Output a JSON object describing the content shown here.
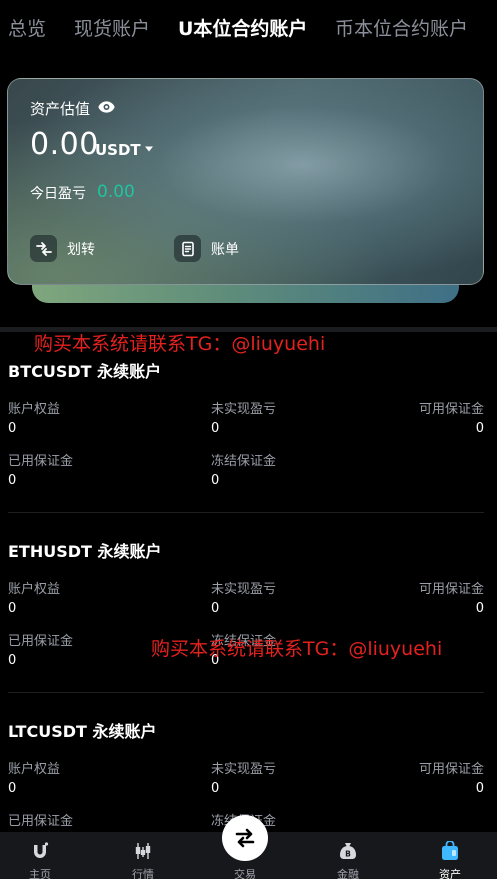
{
  "tabs": [
    {
      "label": "总览",
      "active": false
    },
    {
      "label": "现货账户",
      "active": false
    },
    {
      "label": "U本位合约账户",
      "active": true
    },
    {
      "label": "币本位合约账户",
      "active": false
    }
  ],
  "asset_card": {
    "estimate_label": "资产估值",
    "balance": "0.00",
    "unit": "USDT",
    "today_pnl_label": "今日盈亏",
    "today_pnl_value": "0.00",
    "transfer_label": "划转",
    "bill_label": "账单"
  },
  "watermark": "购买本系统请联系TG：@liuyuehi",
  "accounts": [
    {
      "title": "BTCUSDT 永续账户",
      "equity_label": "账户权益",
      "equity": "0",
      "unrealized_label": "未实现盈亏",
      "unrealized": "0",
      "available_label": "可用保证金",
      "available": "0",
      "used_label": "已用保证金",
      "used": "0",
      "frozen_label": "冻结保证金",
      "frozen": "0"
    },
    {
      "title": "ETHUSDT 永续账户",
      "equity_label": "账户权益",
      "equity": "0",
      "unrealized_label": "未实现盈亏",
      "unrealized": "0",
      "available_label": "可用保证金",
      "available": "0",
      "used_label": "已用保证金",
      "used": "0",
      "frozen_label": "冻结保证金",
      "frozen": "0"
    },
    {
      "title": "LTCUSDT 永续账户",
      "equity_label": "账户权益",
      "equity": "0",
      "unrealized_label": "未实现盈亏",
      "unrealized": "0",
      "available_label": "可用保证金",
      "available": "0",
      "used_label": "已用保证金",
      "frozen_label": "冻结保证金"
    }
  ],
  "bottom_nav": [
    {
      "label": "主页",
      "icon": "home-logo-icon"
    },
    {
      "label": "行情",
      "icon": "candlestick-icon"
    },
    {
      "label": "交易",
      "icon": "swap-arrows-icon"
    },
    {
      "label": "金融",
      "icon": "money-bag-icon"
    },
    {
      "label": "资产",
      "icon": "wallet-bag-icon",
      "active": true
    }
  ],
  "colors": {
    "background": "#000000",
    "accent_green": "#1fc4a0",
    "watermark_red": "#e3211f",
    "active_nav": "#3fb8ff",
    "muted_text": "#9a9ea7"
  }
}
